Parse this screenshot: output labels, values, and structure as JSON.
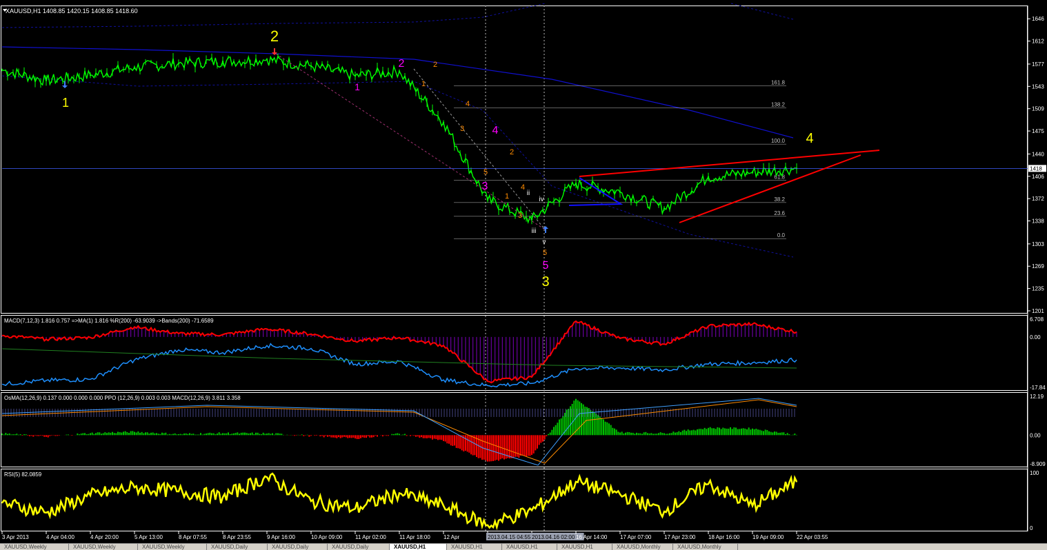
{
  "symbol_header": "XAUUSD,H1  1408.85 1420.15 1408.85 1418.60",
  "colors": {
    "background": "#000000",
    "grid": "#ffffff",
    "bull_candle": "#00ff00",
    "price_line": "#0000ff",
    "bands": "#0000cc",
    "wedge": "#ff0000",
    "fib": "#c0c0c0",
    "macd_hist": "#6a00a0",
    "macd_line": "#ff0000",
    "pctr_line": "#1e90ff",
    "osma_pos": "#00c000",
    "osma_neg": "#ff0000",
    "rsi_line": "#ffff00",
    "wave_yellow": "#ffff00",
    "wave_magenta": "#ff00ff",
    "wave_orange": "#ff8c00",
    "wave_white": "#ffffff"
  },
  "chart_data": [
    {
      "type": "line",
      "panel": "price",
      "ylim": [
        1201,
        1662
      ],
      "yticks": [
        "1646",
        "1612",
        "1577",
        "1543",
        "1509",
        "1475",
        "1440",
        "1406",
        "1372",
        "1338",
        "1303",
        "1269",
        "1235",
        "1201"
      ],
      "current_price_label": "1418",
      "x": [
        "3 Apr 2013",
        "4 Apr 04:00",
        "4 Apr 20:00",
        "5 Apr 13:00",
        "8 Apr 07:55",
        "8 Apr 23:55",
        "9 Apr 16:00",
        "10 Apr 09:00",
        "11 Apr 02:00",
        "11 Apr 18:00",
        "12 Apr",
        "2013.04.15 04:55",
        "2013.04.16 02:00",
        "16 Apr 14:00",
        "17 Apr 07:00",
        "17 Apr 23:00",
        "18 Apr 16:00",
        "19 Apr 09:00",
        "22 Apr 03:55"
      ],
      "close": [
        1568,
        1552,
        1560,
        1572,
        1578,
        1581,
        1584,
        1574,
        1559,
        1566,
        1488,
        1370,
        1340,
        1395,
        1382,
        1357,
        1405,
        1412,
        1418
      ],
      "fibonacci": [
        {
          "level": "161.8",
          "price": 1544
        },
        {
          "level": "138.2",
          "price": 1510
        },
        {
          "level": "100.0",
          "price": 1455
        },
        {
          "level": "61.8",
          "price": 1400
        },
        {
          "level": "38.2",
          "price": 1366
        },
        {
          "level": "23.6",
          "price": 1345
        },
        {
          "level": "0.0",
          "price": 1311
        }
      ],
      "wave_labels": [
        {
          "text": "1",
          "color": "yellow"
        },
        {
          "text": "2",
          "color": "yellow"
        },
        {
          "text": "3",
          "color": "yellow"
        },
        {
          "text": "4",
          "color": "yellow"
        },
        {
          "text": "1",
          "color": "magenta"
        },
        {
          "text": "2",
          "color": "magenta"
        },
        {
          "text": "3",
          "color": "magenta"
        },
        {
          "text": "4",
          "color": "magenta"
        },
        {
          "text": "5",
          "color": "magenta"
        },
        {
          "text": "1",
          "color": "orange"
        },
        {
          "text": "2",
          "color": "orange"
        },
        {
          "text": "3",
          "color": "orange"
        },
        {
          "text": "4",
          "color": "orange"
        },
        {
          "text": "5",
          "color": "orange"
        },
        {
          "text": "2",
          "color": "orange"
        },
        {
          "text": "4",
          "color": "orange"
        },
        {
          "text": "1",
          "color": "orange"
        },
        {
          "text": "3",
          "color": "orange"
        },
        {
          "text": "5",
          "color": "orange"
        },
        {
          "text": "ii",
          "color": "white"
        },
        {
          "text": "iii",
          "color": "white"
        },
        {
          "text": "iv",
          "color": "white"
        },
        {
          "text": "v",
          "color": "white"
        }
      ]
    },
    {
      "type": "line",
      "panel": "macd",
      "header": "MACD(7,12,3) 1.816 0.757   =>MA(1) 1.816  %R(200) -63.9039  ->Bands(200) -71.6589",
      "ylim": [
        -17.84,
        6.708
      ],
      "yticks": [
        "6.708",
        "0.00",
        "-17.84"
      ],
      "series": [
        {
          "name": "MACD",
          "values": [
            0.5,
            -0.8,
            -0.2,
            3.5,
            1.2,
            0.8,
            2.8,
            1.0,
            -1.5,
            -0.2,
            -3.0,
            -15.5,
            -14.0,
            5.5,
            -0.5,
            -2.5,
            3.8,
            4.5,
            1.8
          ]
        },
        {
          "name": "%R",
          "values": [
            -16.5,
            -15.2,
            -14.8,
            -8.0,
            -4.5,
            -5.5,
            -3.0,
            -4.0,
            -9.5,
            -8.5,
            -15.0,
            -17.0,
            -16.2,
            -11.0,
            -10.8,
            -11.5,
            -9.5,
            -9.0,
            -8.0
          ]
        }
      ]
    },
    {
      "type": "bar",
      "panel": "osma",
      "header": "OsMA(12,26,9) 0.137 0.000 0.000 0.000  PPO (12,26,9) 0.003 0.003  MACD(12,26,9) 3.811 3.358",
      "ylim": [
        -8.909,
        12.19
      ],
      "yticks": [
        "12.19",
        "0.00",
        "-8.909"
      ],
      "values": [
        0.5,
        -0.5,
        0.6,
        1.0,
        0.3,
        0.6,
        0.5,
        -0.2,
        -1.0,
        0.4,
        -1.8,
        -8.0,
        -6.0,
        11.0,
        0.8,
        0.6,
        2.2,
        2.0,
        0.1
      ]
    },
    {
      "type": "line",
      "panel": "rsi",
      "header": "RSI(5) 82.0859",
      "ylim": [
        0,
        100
      ],
      "yticks": [
        "100",
        "0"
      ],
      "values": [
        45,
        28,
        58,
        72,
        65,
        55,
        90,
        48,
        35,
        62,
        40,
        6,
        32,
        82,
        60,
        30,
        78,
        40,
        82
      ]
    }
  ],
  "tabs": [
    "XAUUSD,Weekly",
    "XAUUSD,Weekly",
    "XAUUSD,Weekly",
    "XAUUSD,Daily",
    "XAUUSD,Daily",
    "XAUUSD,Daily",
    "XAUUSD,H1",
    "XAUUSD,H1",
    "XAUUSD,H1",
    "XAUUSD,H1",
    "XAUUSD,Monthly",
    "XAUUSD,Monthly"
  ]
}
